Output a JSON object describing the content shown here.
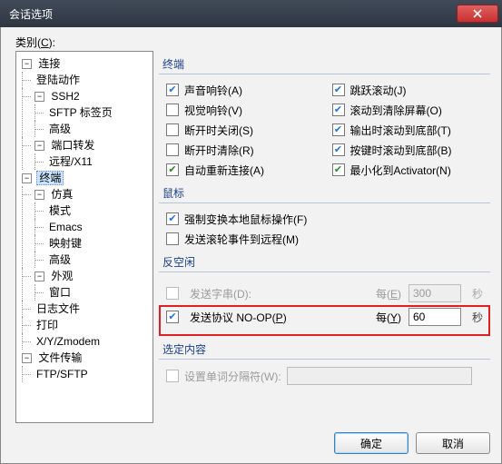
{
  "window": {
    "title": "会话选项"
  },
  "category": {
    "label_pre": "类别(",
    "label_key": "C",
    "label_post": "):"
  },
  "tree": {
    "root": "连接",
    "conn": {
      "loginAction": "登陆动作",
      "ssh2": "SSH2",
      "sftpTab": "SFTP 标签页",
      "advanced": "高级",
      "portForward": "端口转发",
      "remoteX11": "远程/X11"
    },
    "terminal": "终端",
    "term": {
      "emulation": "仿真",
      "mode": "模式",
      "emacs": "Emacs",
      "keymap": "映射键",
      "advanced": "高级",
      "appearance": "外观",
      "window": "窗口",
      "logfile": "日志文件",
      "print": "打印",
      "xyz": "X/Y/Zmodem"
    },
    "fileTransfer": "文件传输",
    "ftp": "FTP/SFTP"
  },
  "panel": {
    "terminal": "终端",
    "opts": {
      "audioBell": "声音响铃(A)",
      "visualBell": "视觉响铃(V)",
      "closeOnDisconnect": "断开时关闭(S)",
      "clearOnDisconnect": "断开时清除(R)",
      "autoReconnect": "自动重新连接(A)",
      "jumpScroll": "跳跃滚动(J)",
      "clearScrollbackOnScroll": "滚动到清除屏幕(O)",
      "scrollToBottomOnOutput": "输出时滚动到底部(T)",
      "scrollToBottomOnKey": "按键时滚动到底部(B)",
      "minimizeToActivator": "最小化到Activator(N)"
    },
    "mouse": "鼠标",
    "mouseOpts": {
      "forceLocalMouse": "强制变换本地鼠标操作(F)",
      "sendWheelRemote": "发送滚轮事件到远程(M)"
    },
    "antiIdle": "反空闲",
    "antiIdleOpts": {
      "sendString": "发送字串(D):",
      "sendProtocol_pre": "发送协议 NO-OP(",
      "sendProtocol_key": "P",
      "sendProtocol_post": ")",
      "every_pre": "每(",
      "every_keyE": "E",
      "every_keyY": "Y",
      "every_post": ")",
      "valE": "300",
      "valY": "60",
      "seconds": "秒"
    },
    "selection": "选定内容",
    "selOpts": {
      "wordDelimiters": "设置单词分隔符(W):"
    }
  },
  "buttons": {
    "ok": "确定",
    "cancel": "取消"
  }
}
